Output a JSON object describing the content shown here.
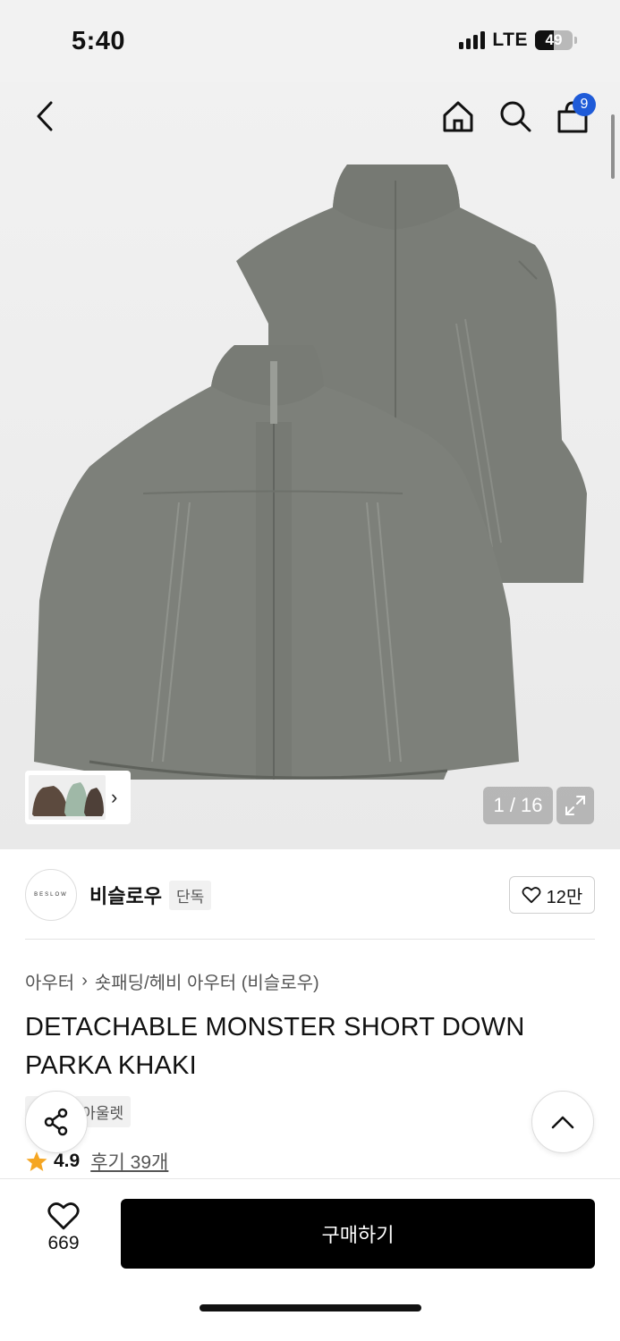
{
  "status_bar": {
    "time": "5:40",
    "network": "LTE",
    "battery": "49",
    "battery_level": 0.49
  },
  "header": {
    "cart_count": "9"
  },
  "gallery": {
    "counter": "1 / 16"
  },
  "brand": {
    "logo_text": "BESLOW",
    "name": "비슬로우",
    "badge": "단독",
    "likes": "12만"
  },
  "breadcrumb": {
    "category": "아우터",
    "subcategory": "숏패딩/헤비 아우터 (비슬로우)"
  },
  "product": {
    "title": "DETACHABLE MONSTER SHORT DOWN PARKA KHAKI"
  },
  "tags": [
    "단독",
    "아울렛"
  ],
  "rating": {
    "score": "4.9",
    "reviews": "후기 39개"
  },
  "bottom_bar": {
    "wish_count": "669",
    "buy_label": "구매하기"
  },
  "icons": {
    "back": "chevron-left-icon",
    "home": "home-icon",
    "search": "search-icon",
    "cart": "shopping-bag-icon",
    "expand": "expand-icon",
    "share": "share-icon",
    "scroll_top": "chevron-up-icon",
    "star": "star-icon",
    "heart": "heart-icon"
  },
  "colors": {
    "star": "#f5a623",
    "badge": "#1f5bd8",
    "buy_button": "#000000",
    "product": "#7a7d77"
  }
}
